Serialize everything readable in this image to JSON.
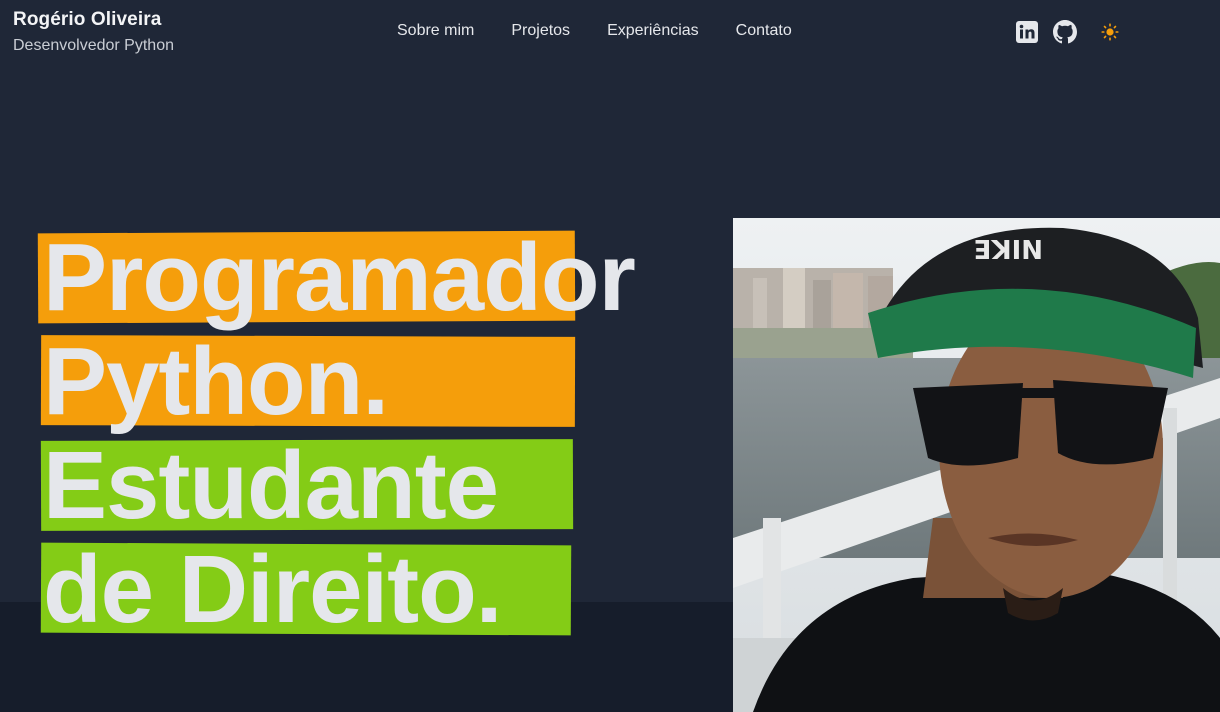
{
  "brand": {
    "name": "Rogério Oliveira",
    "role": "Desenvolvedor Python"
  },
  "nav": [
    "Sobre mim",
    "Projetos",
    "Experiências",
    "Contato"
  ],
  "icons": {
    "linkedin": "linkedin-icon",
    "github": "github-icon",
    "theme": "sun-icon"
  },
  "hero": {
    "lines": [
      "Programador",
      "Python.",
      "Estudante",
      "de Direito."
    ],
    "colors": {
      "orange": "#f59e0b",
      "green": "#84cc16"
    }
  },
  "photo": {
    "subject": "profile-photo"
  }
}
